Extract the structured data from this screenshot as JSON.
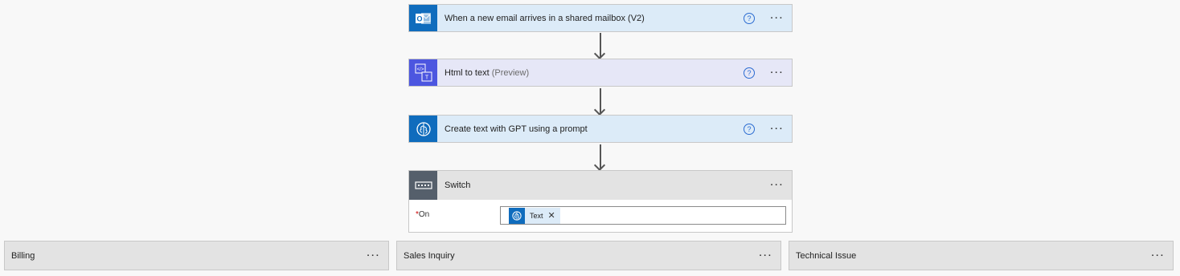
{
  "steps": [
    {
      "title": "When a new email arrives in a shared mailbox (V2)",
      "icon": "outlook-icon"
    },
    {
      "title": "Html to text",
      "suffix": "(Preview)",
      "icon": "html-to-text-icon"
    },
    {
      "title": "Create text with GPT using a prompt",
      "icon": "ai-brain-icon"
    }
  ],
  "help_glyph": "?",
  "more_glyph": "···",
  "switch": {
    "title": "Switch",
    "on_required": "*",
    "on_label": "On",
    "token_label": "Text",
    "token_remove": "✕"
  },
  "cases": [
    {
      "title": "Billing"
    },
    {
      "title": "Sales Inquiry"
    },
    {
      "title": "Technical Issue"
    }
  ],
  "colors": {
    "outlook": "#0f6cbd",
    "html_connector": "#4c56e0",
    "ai_builder": "#0f6cbd",
    "control": "#555f6b",
    "help_blue": "#2a6bd1"
  }
}
